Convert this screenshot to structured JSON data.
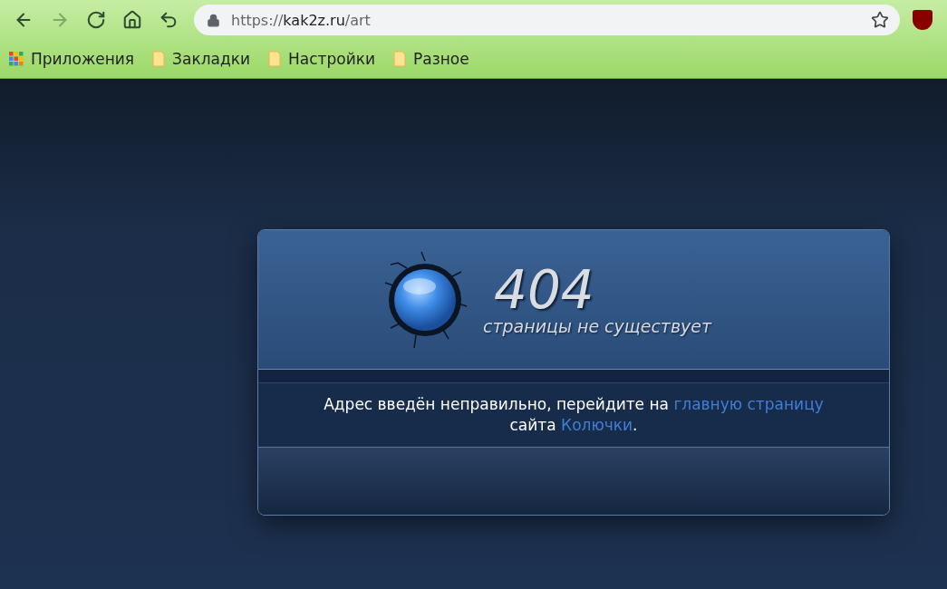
{
  "toolbar": {
    "buttons": [
      {
        "kind": "back",
        "disabled": false
      },
      {
        "kind": "forward",
        "disabled": true
      },
      {
        "kind": "reload",
        "disabled": false
      },
      {
        "kind": "home",
        "disabled": false
      },
      {
        "kind": "undo",
        "disabled": false
      }
    ],
    "address": {
      "scheme": "https://",
      "host": "kak2z.ru",
      "path": "/art"
    }
  },
  "bookmarks": [
    {
      "kind": "apps",
      "label": "Приложения"
    },
    {
      "kind": "folder",
      "label": "Закладки"
    },
    {
      "kind": "folder",
      "label": "Настройки"
    },
    {
      "kind": "folder",
      "label": "Разное"
    }
  ],
  "error_card": {
    "code": "404",
    "subtitle": "страницы не существует",
    "message": [
      {
        "kind": "text",
        "text": "Адрес введён неправильно, перейдите на "
      },
      {
        "kind": "link",
        "text": "главную страницу"
      },
      {
        "kind": "text",
        "text": " сайта "
      },
      {
        "kind": "link",
        "text": "Колючки"
      },
      {
        "kind": "text",
        "text": "."
      }
    ]
  }
}
